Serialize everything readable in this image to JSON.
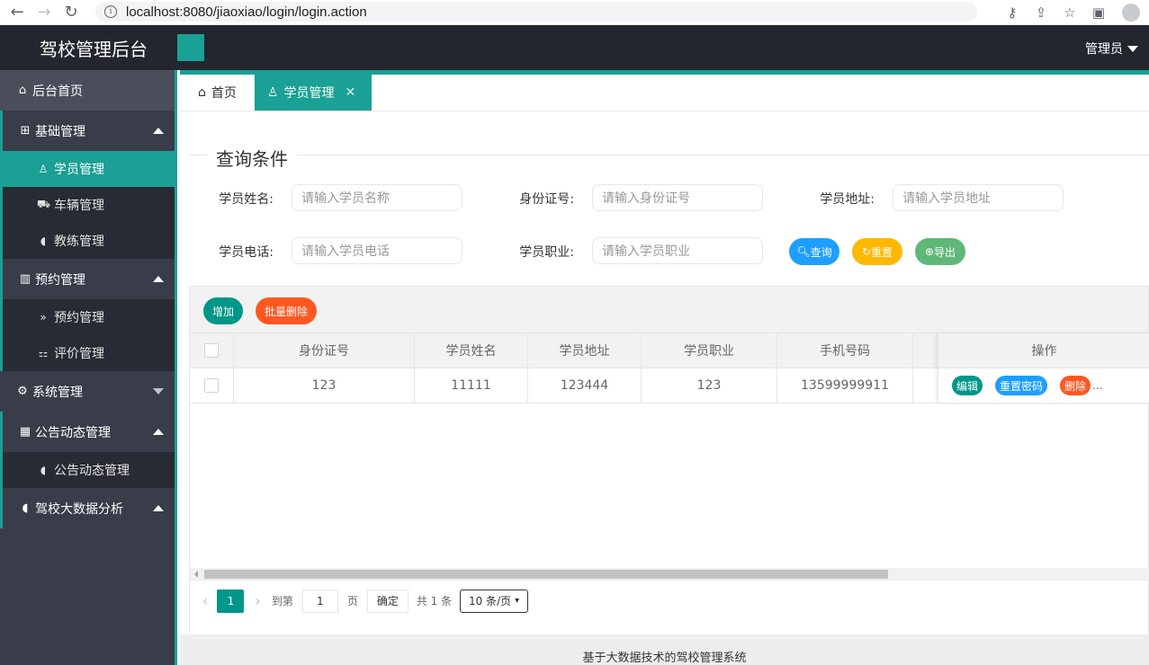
{
  "browser": {
    "url": "localhost:8080/jiaoxiao/login/login.action"
  },
  "header": {
    "title": "驾校管理后台",
    "user_menu": "管理员"
  },
  "sidebar": {
    "home": "后台首页",
    "groups": [
      {
        "label": "基础管理",
        "items": [
          "学员管理",
          "车辆管理",
          "教练管理"
        ]
      },
      {
        "label": "预约管理",
        "items": [
          "预约管理",
          "评价管理"
        ]
      },
      {
        "label": "系统管理",
        "items": []
      },
      {
        "label": "公告动态管理",
        "items": [
          "公告动态管理"
        ]
      },
      {
        "label": "驾校大数据分析",
        "items": []
      }
    ]
  },
  "tabs": [
    {
      "label": "首页"
    },
    {
      "label": "学员管理"
    }
  ],
  "search": {
    "legend": "查询条件",
    "fields": [
      {
        "label": "学员姓名:",
        "placeholder": "请输入学员名称"
      },
      {
        "label": "身份证号:",
        "placeholder": "请输入身份证号"
      },
      {
        "label": "学员地址:",
        "placeholder": "请输入学员地址"
      },
      {
        "label": "学员电话:",
        "placeholder": "请输入学员电话"
      },
      {
        "label": "学员职业:",
        "placeholder": "请输入学员职业"
      }
    ],
    "query_label": "查询",
    "reset_label": "重置",
    "export_label": "导出"
  },
  "toolbar": {
    "add_label": "增加",
    "batch_delete_label": "批量删除"
  },
  "table": {
    "columns": [
      "身份证号",
      "学员姓名",
      "学员地址",
      "学员职业",
      "手机号码",
      "操作"
    ],
    "rows": [
      {
        "id_card": "123",
        "name": "11111",
        "address": "123444",
        "job": "123",
        "phone": "13599999911"
      }
    ],
    "actions": {
      "edit": "编辑",
      "reset_pwd": "重置密码",
      "delete": "删除",
      "more": "..."
    }
  },
  "pager": {
    "current": "1",
    "goto_label": "到第",
    "goto_value": "1",
    "page_unit": "页",
    "confirm_label": "确定",
    "total": "共 1 条",
    "page_size": "10 条/页"
  },
  "footer": {
    "text": "基于大数据技术的驾校管理系统"
  },
  "colors": {
    "accent": "#1aa094",
    "sidebar_bg": "#393d49",
    "header_bg": "#23262e",
    "blue": "#1e9fff",
    "orange": "#ffb800",
    "green": "#5fb878",
    "red": "#ff5722",
    "teal": "#009688"
  }
}
